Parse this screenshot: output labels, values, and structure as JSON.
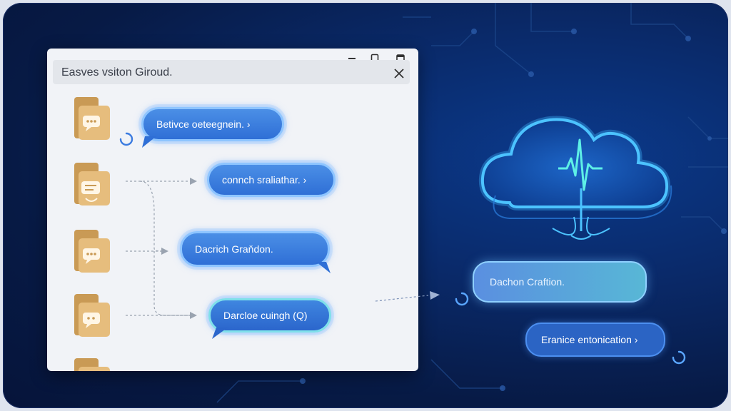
{
  "window": {
    "title": "Easves vsiton Giroud.",
    "minimize_icon": "minimize-icon",
    "maximize_icon": "maximize-icon",
    "restore_icon": "restore-icon",
    "close_icon": "close-icon"
  },
  "chat_messages": [
    {
      "label": "Betivce oeteegnein. ›",
      "icon": "chat-file-icon"
    },
    {
      "label": "connch sraliathar. ›",
      "icon": "document-file-icon"
    },
    {
      "label": "Dacrich Graňdon.",
      "icon": "chat-file-icon"
    },
    {
      "label": "Darcloe cuingh  (Q)",
      "icon": "chat-file-icon"
    }
  ],
  "cloud": {
    "icon": "cloud-heartbeat-icon"
  },
  "output_messages": [
    {
      "label": "Dachon Craftion."
    },
    {
      "label": "Eranice entonication ›"
    }
  ],
  "colors": {
    "background": "#071a45",
    "bubble_blue": "#2f6fd6",
    "glow_cyan": "#3fd6e6",
    "folder_gold": "#e3b978"
  }
}
